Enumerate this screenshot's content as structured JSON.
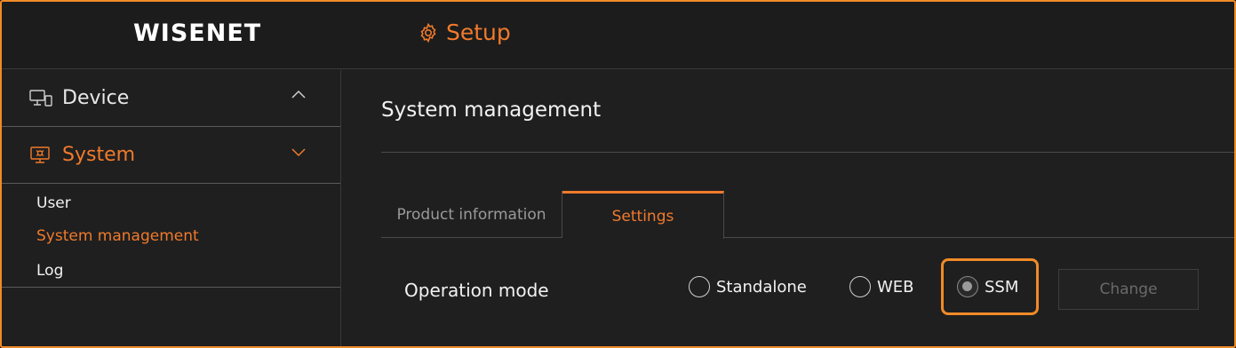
{
  "header": {
    "logo": "WISENET",
    "title": "Setup"
  },
  "sidebar": {
    "items": [
      {
        "label": "Device",
        "icon": "monitor-devices-icon",
        "expanded": false
      },
      {
        "label": "System",
        "icon": "system-settings-icon",
        "expanded": true,
        "active": true
      }
    ],
    "submenu": [
      "User",
      "System management",
      "Log"
    ],
    "active_submenu": "System management"
  },
  "main": {
    "title": "System management",
    "tabs": [
      {
        "label": "Product information",
        "active": false
      },
      {
        "label": "Settings",
        "active": true
      }
    ],
    "operation_mode": {
      "label": "Operation mode",
      "options": [
        "Standalone",
        "WEB",
        "SSM"
      ],
      "selected": "SSM"
    },
    "change_label": "Change"
  },
  "colors": {
    "accent": "#f07a2c",
    "background": "#1f1f1f",
    "text": "#f2f2f2"
  }
}
